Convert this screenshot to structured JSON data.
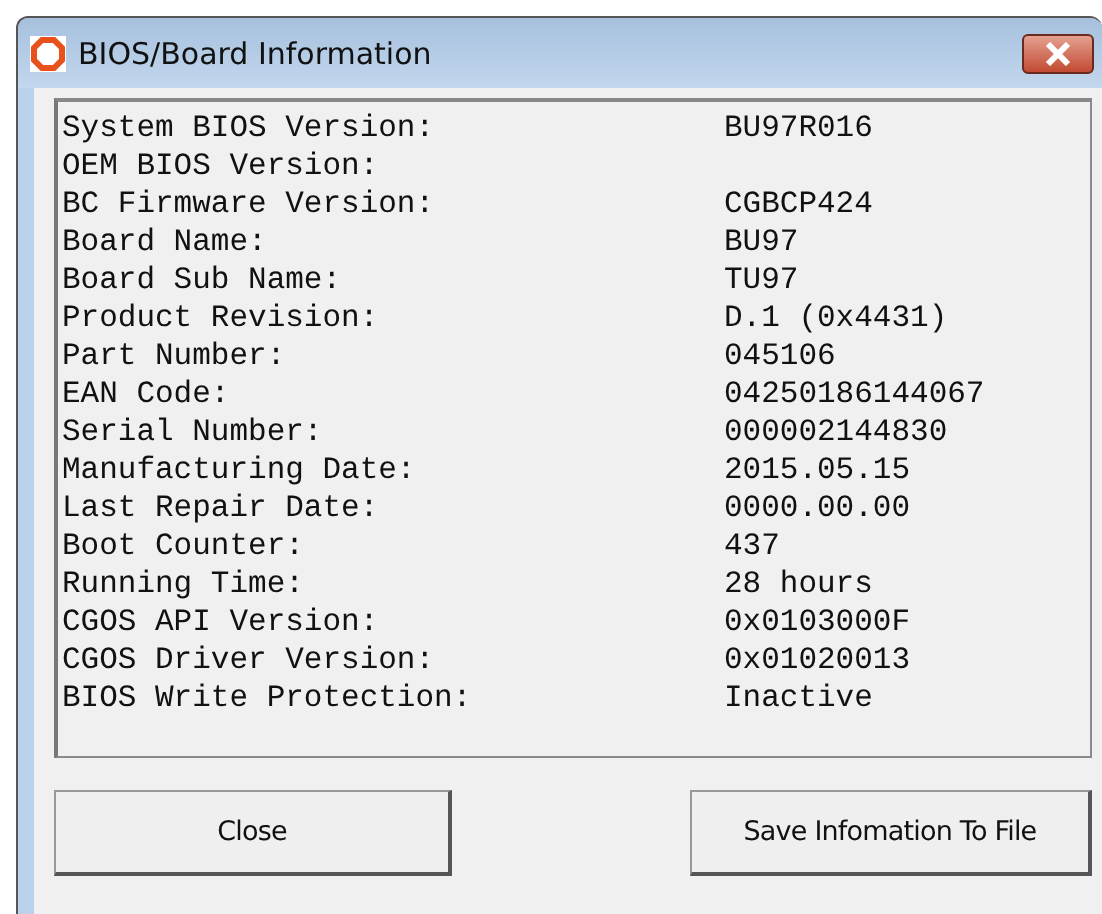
{
  "window": {
    "title": "BIOS/Board Information"
  },
  "info": [
    {
      "label": "System BIOS Version:",
      "value": "BU97R016"
    },
    {
      "label": "OEM BIOS Version:"
    },
    {
      "label": "BC Firmware Version:",
      "value": "CGBCP424"
    },
    {
      "label": "Board Name:",
      "value": "BU97"
    },
    {
      "label": "Board Sub Name:",
      "value": "TU97"
    },
    {
      "label": "Product Revision:",
      "value": "D.1 (0x4431)"
    },
    {
      "label": "Part Number:",
      "value": "045106"
    },
    {
      "label": "EAN Code:",
      "value": "04250186144067"
    },
    {
      "label": "Serial Number:",
      "value": "000002144830"
    },
    {
      "label": "Manufacturing Date:",
      "value": "2015.05.15"
    },
    {
      "label": "Last Repair Date:",
      "value": "0000.00.00"
    },
    {
      "label": "Boot Counter:",
      "value": "437"
    },
    {
      "label": "Running Time:",
      "value": "28 hours"
    },
    {
      "label": "CGOS API Version:",
      "value": "0x0103000F"
    },
    {
      "label": "CGOS Driver Version:",
      "value": "0x01020013"
    },
    {
      "label": "BIOS Write Protection:",
      "value": "Inactive"
    }
  ],
  "buttons": [
    "Close",
    "Save Infomation To File"
  ]
}
